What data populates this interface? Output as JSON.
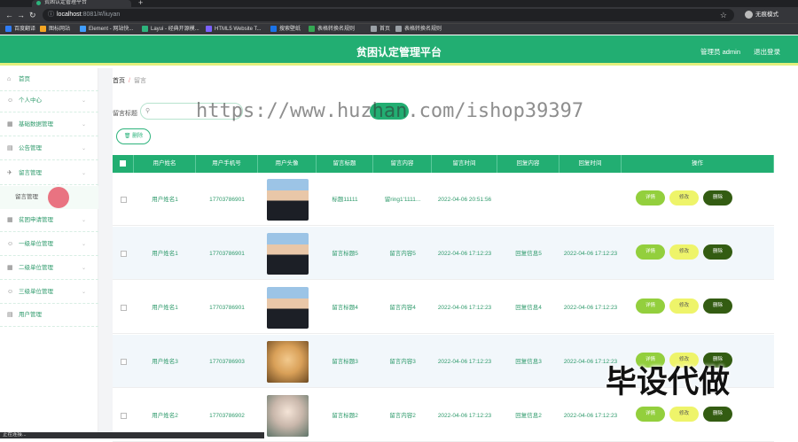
{
  "browser": {
    "tab_title": "贫困认定管理平台",
    "url_host": "localhost",
    "url_path": ":8081/#/liuyan",
    "profile_label": "无痕模式",
    "bookmarks": [
      {
        "label": "百度翻译",
        "color": "#2f7df6"
      },
      {
        "label": "图标网站",
        "color": "#f5a623"
      },
      {
        "label": "Element - 网站快...",
        "color": "#409eff"
      },
      {
        "label": "Layui - 经典开源模...",
        "color": "#2db37c"
      },
      {
        "label": "HTML5 Website T...",
        "color": "#7b61ff"
      },
      {
        "label": "搜索壁纸",
        "color": "#1a73e8"
      },
      {
        "label": "表格转换名规则",
        "color": "#34a853"
      },
      {
        "label": "首页",
        "color": "#9aa0a6"
      },
      {
        "label": "表格转换名规则",
        "color": "#9aa0a6"
      }
    ]
  },
  "header": {
    "title": "贫困认定管理平台",
    "admin_label": "管理员 admin",
    "logout_label": "退出登录"
  },
  "sidebar": {
    "items": [
      {
        "label": "首页",
        "icon": "home-icon",
        "glyph": "⌂",
        "expandable": false
      },
      {
        "label": "个人中心",
        "icon": "user-icon",
        "glyph": "☺",
        "expandable": true
      },
      {
        "label": "基础数据管理",
        "icon": "grid-icon",
        "glyph": "▦",
        "expandable": true
      },
      {
        "label": "公告管理",
        "icon": "notice-icon",
        "glyph": "▤",
        "expandable": true
      },
      {
        "label": "留言管理",
        "icon": "send-icon",
        "glyph": "✈",
        "expandable": true
      },
      {
        "label": "贫困申请管理",
        "icon": "grid-icon",
        "glyph": "▦",
        "expandable": true
      },
      {
        "label": "一级单位管理",
        "icon": "user-icon",
        "glyph": "☺",
        "expandable": true
      },
      {
        "label": "二级单位管理",
        "icon": "grid-icon",
        "glyph": "▦",
        "expandable": true
      },
      {
        "label": "三级单位管理",
        "icon": "user-icon",
        "glyph": "☺",
        "expandable": true
      },
      {
        "label": "用户管理",
        "icon": "notice-icon",
        "glyph": "▤",
        "expandable": false
      }
    ],
    "sub_item": "留言管理"
  },
  "breadcrumb": {
    "home": "首页",
    "separator": "/",
    "current": "留言"
  },
  "search": {
    "label": "留言标题",
    "placeholder": "留言标题"
  },
  "toolbar": {
    "delete_label": "删除"
  },
  "table": {
    "columns": [
      "用户姓名",
      "用户手机号",
      "用户头像",
      "留言标题",
      "留言内容",
      "留言时间",
      "回复内容",
      "回复时间",
      "操作"
    ],
    "rows": [
      {
        "name": "用户姓名1",
        "phone": "17703786901",
        "avatar": "boy",
        "title": "标题11111",
        "content": "留ring1'1111...",
        "time": "2022-04-06 20:51:56",
        "reply": "",
        "reply_time": ""
      },
      {
        "name": "用户姓名1",
        "phone": "17703786901",
        "avatar": "boy",
        "title": "留言标题5",
        "content": "留言内容5",
        "time": "2022-04-06 17:12:23",
        "reply": "回复信息5",
        "reply_time": "2022-04-06 17:12:23"
      },
      {
        "name": "用户姓名1",
        "phone": "17703786901",
        "avatar": "boy",
        "title": "留言标题4",
        "content": "留言内容4",
        "time": "2022-04-06 17:12:23",
        "reply": "回复信息4",
        "reply_time": "2022-04-06 17:12:23"
      },
      {
        "name": "用户姓名3",
        "phone": "17703786903",
        "avatar": "dog",
        "title": "留言标题3",
        "content": "留言内容3",
        "time": "2022-04-06 17:12:23",
        "reply": "回复信息3",
        "reply_time": "2022-04-06 17:12:23"
      },
      {
        "name": "用户姓名2",
        "phone": "17703786902",
        "avatar": "girl",
        "title": "留言标题2",
        "content": "留言内容2",
        "time": "2022-04-06 17:12:23",
        "reply": "回复信息2",
        "reply_time": "2022-04-06 17:12:23"
      }
    ],
    "actions": {
      "detail": "详情",
      "edit": "修改",
      "delete": "删除"
    }
  },
  "watermark": "https://www.huzhan.com/ishop39397",
  "overlay_text": "毕设代做",
  "status_text": "正在连接..."
}
